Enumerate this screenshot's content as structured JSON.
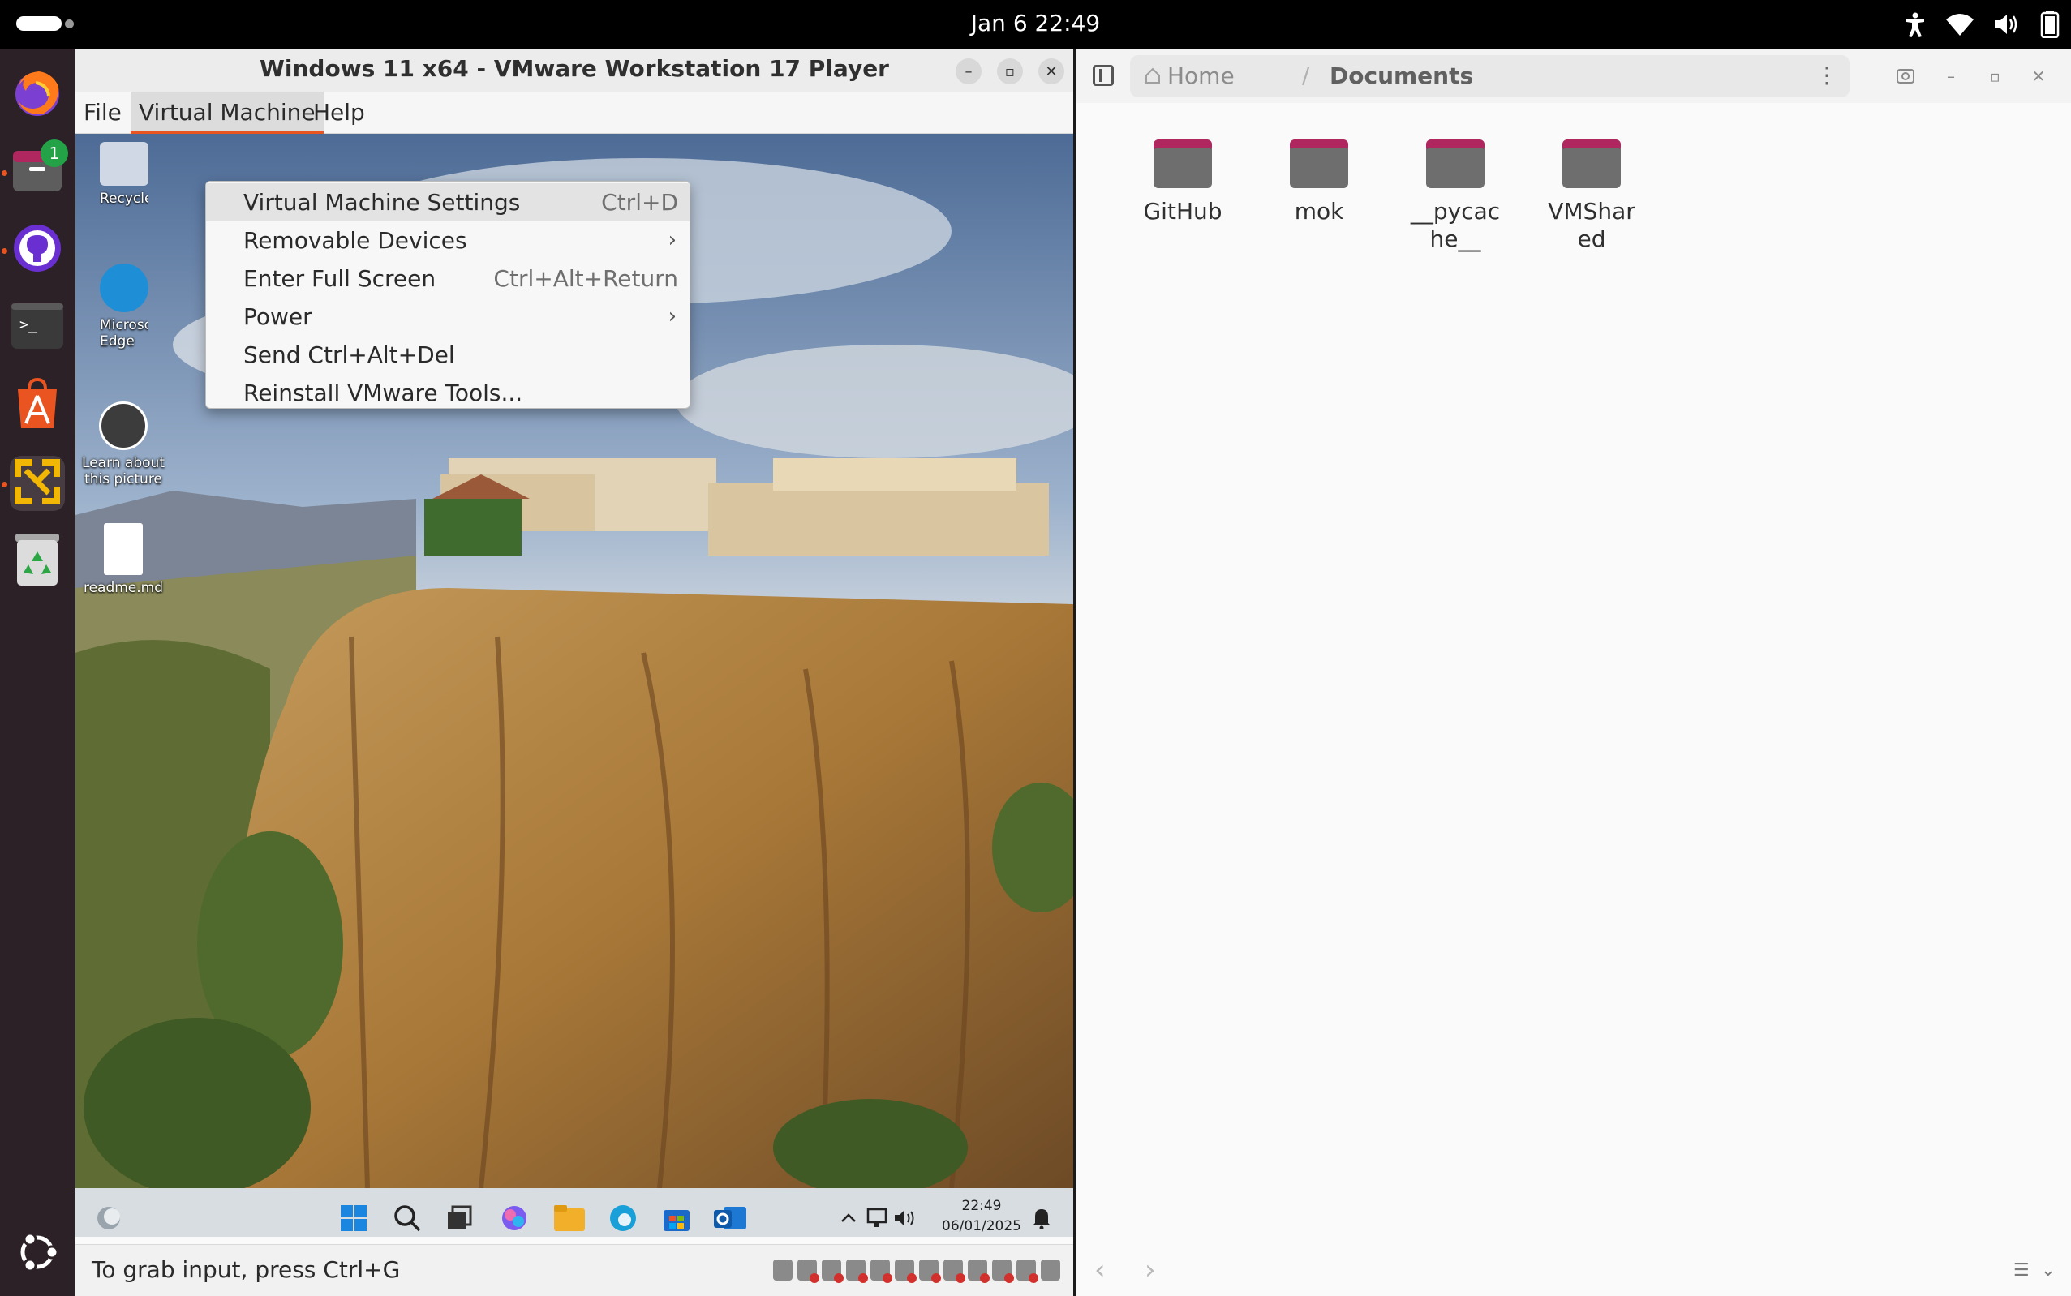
{
  "topbar": {
    "clock": "Jan 6  22:49",
    "icons": [
      "accessibility-icon",
      "wifi-icon",
      "volume-icon",
      "battery-icon"
    ]
  },
  "dock": {
    "items": [
      "firefox",
      "files",
      "github-desktop",
      "terminal",
      "app-center",
      "vmware-workstation",
      "trash",
      "show-apps"
    ],
    "files_badge": "1"
  },
  "vmware": {
    "title": "Windows 11 x64 - VMware Workstation 17 Player",
    "menu": {
      "file": "File",
      "virtual_machine": "Virtual Machine",
      "help": "Help"
    },
    "dropdown": [
      {
        "label": "Virtual Machine Settings",
        "accel": "Ctrl+D"
      },
      {
        "label": "Removable Devices",
        "accel": ""
      },
      {
        "label": "Enter Full Screen",
        "accel": "Ctrl+Alt+Return"
      },
      {
        "label": "Power",
        "accel": ""
      },
      {
        "label": "Send Ctrl+Alt+Del",
        "accel": ""
      },
      {
        "label": "Reinstall VMware Tools...",
        "accel": ""
      }
    ],
    "status_text": "To grab input, press Ctrl+G",
    "guest": {
      "desktop_icons": {
        "recycle": "Recycle",
        "edge": "Microsoft Edge",
        "learn": "Learn about this picture",
        "readme": "readme.md"
      },
      "taskbar_time": "22:49",
      "taskbar_date": "06/01/2025"
    }
  },
  "files": {
    "breadcrumb_home": "Home",
    "breadcrumb_separator": "/",
    "breadcrumb_current": "Documents",
    "folders": [
      {
        "name": "GitHub"
      },
      {
        "name": "mok"
      },
      {
        "name": "__pycache__"
      },
      {
        "name": "VMShared"
      }
    ]
  },
  "colors": {
    "accent": "#e95420",
    "folder": "#6e6e6e",
    "folder_tab": "#b0265f",
    "dock_bg": "#2b2126"
  }
}
